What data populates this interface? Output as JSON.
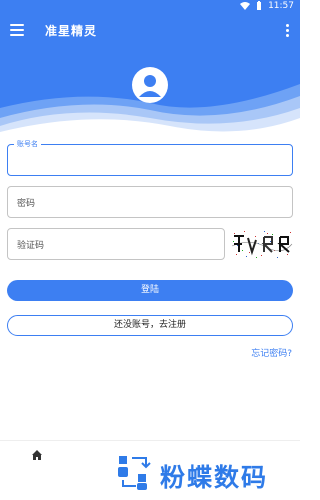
{
  "status_bar": {
    "time": "11:57",
    "wifi_icon": "wifi-icon",
    "battery_icon": "battery-icon"
  },
  "app_bar": {
    "title": "准星精灵",
    "menu_icon": "menu-icon",
    "more_icon": "more-vert-icon"
  },
  "colors": {
    "primary": "#3d7ff2",
    "border": "#c4c4c4",
    "text": "#222222"
  },
  "form": {
    "account": {
      "label": "账号名",
      "value": ""
    },
    "password": {
      "placeholder": "密码",
      "value": ""
    },
    "captcha": {
      "placeholder": "验证码",
      "value": "",
      "image_icon": "captcha-image"
    }
  },
  "actions": {
    "login_label": "登陆",
    "register_label": "还没账号，去注册",
    "forgot_label": "忘记密码?"
  },
  "bottom_nav": {
    "home_icon": "home-icon"
  },
  "watermark": {
    "text": "粉蝶数码"
  }
}
